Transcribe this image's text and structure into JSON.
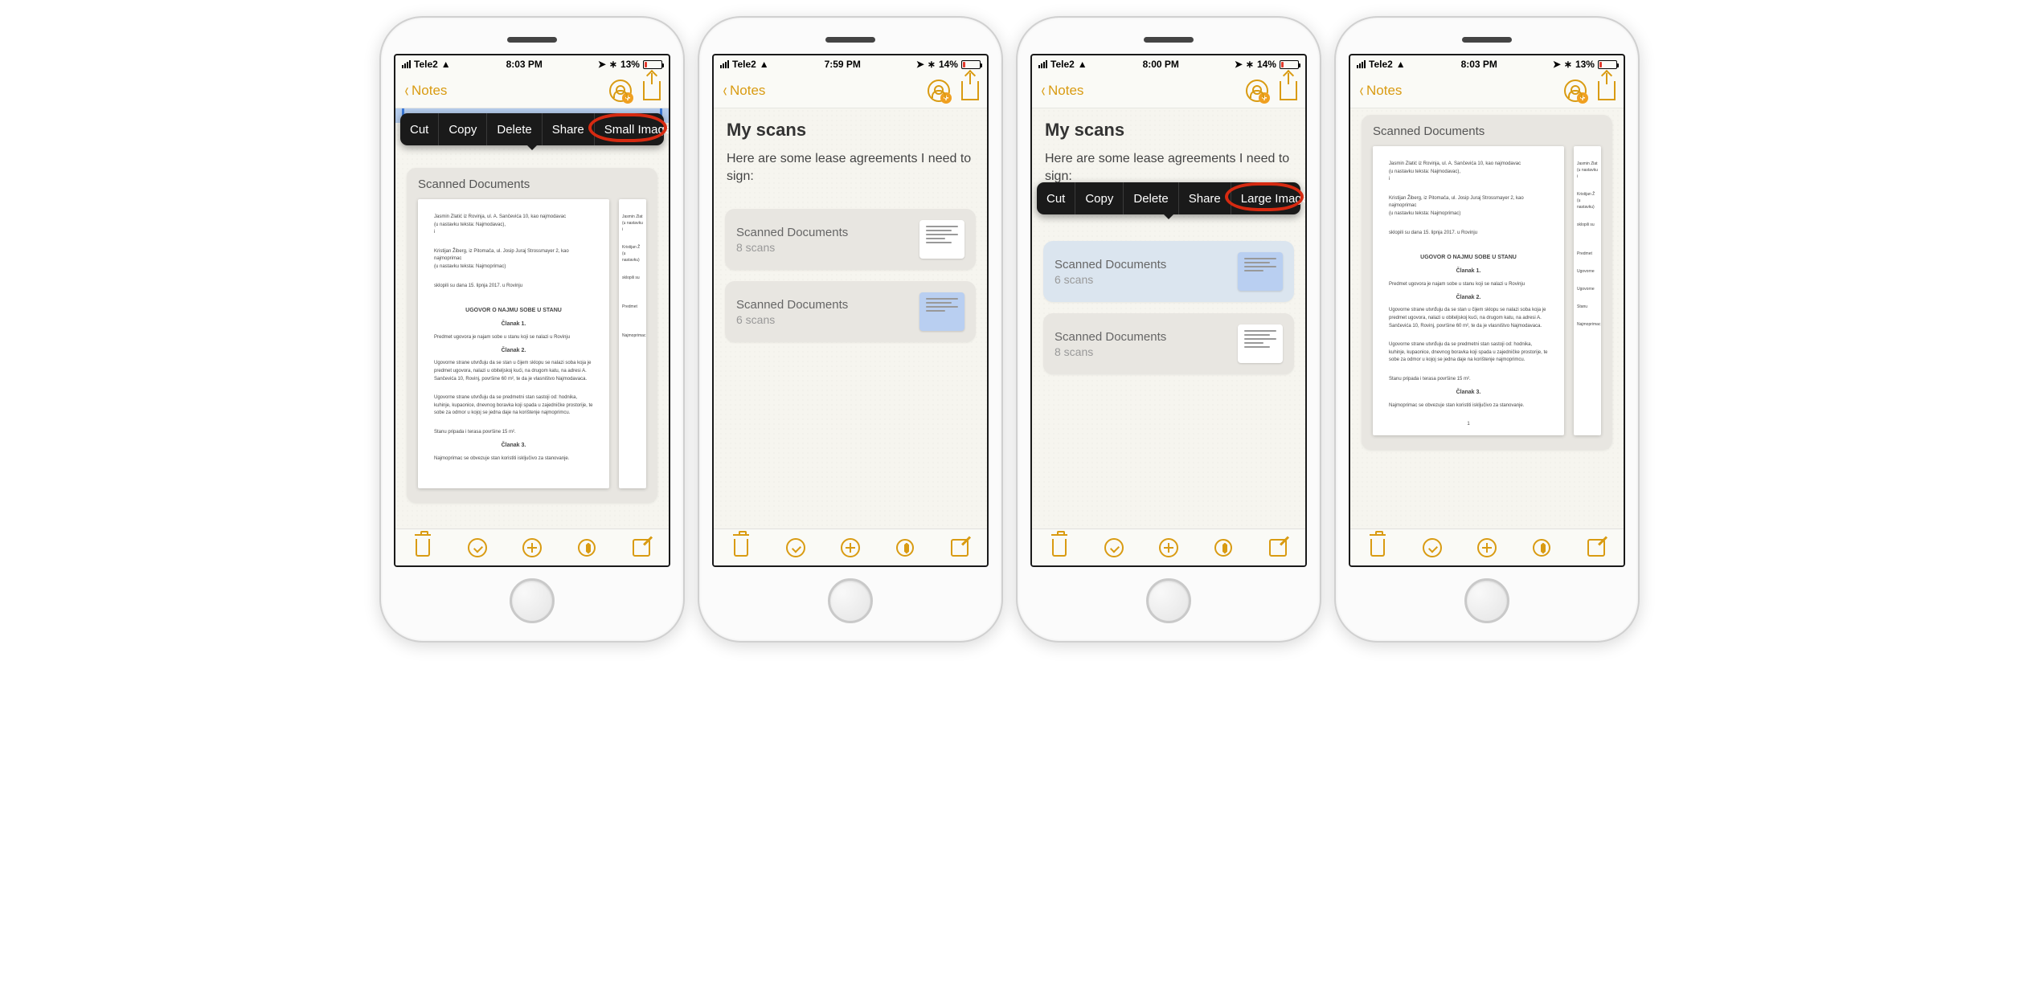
{
  "notes_back": "Notes",
  "context_menu": {
    "cut": "Cut",
    "copy": "Copy",
    "delete": "Delete",
    "share": "Share",
    "small_images": "Small Images",
    "large_images": "Large Images"
  },
  "scanned_docs_label": "Scanned Documents",
  "screens": [
    {
      "status": {
        "carrier": "Tele2",
        "time": "8:03 PM",
        "battery": "13%"
      }
    },
    {
      "status": {
        "carrier": "Tele2",
        "time": "7:59 PM",
        "battery": "14%"
      },
      "title": "My scans",
      "body": "Here are some lease agreements I need to sign:",
      "cards": [
        {
          "title": "Scanned Documents",
          "sub": "8 scans"
        },
        {
          "title": "Scanned Documents",
          "sub": "6 scans"
        }
      ]
    },
    {
      "status": {
        "carrier": "Tele2",
        "time": "8:00 PM",
        "battery": "14%"
      },
      "title": "My scans",
      "body": "Here are some lease agreements I need to sign:",
      "cards": [
        {
          "title": "Scanned Documents",
          "sub": "6 scans"
        },
        {
          "title": "Scanned Documents",
          "sub": "8 scans"
        }
      ]
    },
    {
      "status": {
        "carrier": "Tele2",
        "time": "8:03 PM",
        "battery": "13%"
      }
    }
  ],
  "doc_sample": {
    "line1": "Jasmin Zlatić iz Rovinja, ul. A. Sančevića 10, kao najmodavac",
    "line2": "(u nastavku teksta: Najmodavac),",
    "line3": "Kristijan Žiberg, iz Pitomača, ul. Josip Juraj Strossmayer 2, kao najmoprimac",
    "line4": "(u nastavku teksta: Najmoprimac)",
    "line5": "sklopili su dana 15. lipnja 2017. u Rovinju",
    "heading": "UGOVOR O NAJMU SOBE U STANU",
    "c1": "Članak 1.",
    "p1": "Predmet ugovora je najam sobe u stanu koji se nalazi u Rovinju",
    "c2": "Članak 2.",
    "p2a": "Ugovorne strane utvrđuju da se stan u čijem sklopu se nalazi soba koja je predmet ugovora, nalazi u obiteljskoj kući, na drugom katu, na adresi A. Sančevića 10, Rovinj, površine 60 m², te da je vlasništvo Najmodavaca.",
    "p2b": "Ugovorne strane utvrđuju da se predmetni stan sastoji od: hodnika, kuhinje, kupaonice, dnevnog boravka koji spada u zajedničke prostorije, te sobe za odmor u kojoj se jedna daje na korištenje najmoprimcu.",
    "p2c": "Stanu pripada i terasa površine 15 m².",
    "c3": "Članak 3.",
    "p3": "Najmoprimac se obvezuje stan koristiti isključivo za stanovanje."
  }
}
